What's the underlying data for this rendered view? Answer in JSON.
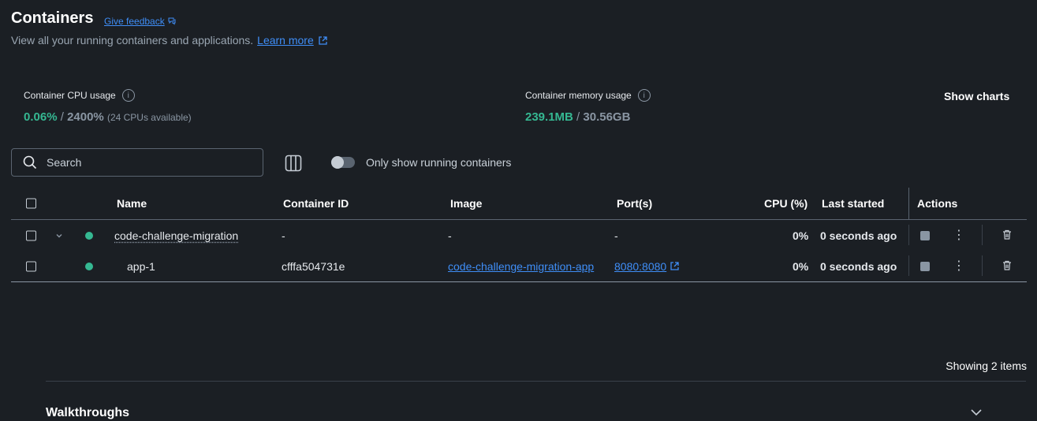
{
  "header": {
    "title": "Containers",
    "feedback_label": "Give feedback",
    "subtitle": "View all your running containers and applications.",
    "learn_more": "Learn more"
  },
  "stats": {
    "cpu_label": "Container CPU usage",
    "cpu_used": "0.06%",
    "cpu_sep": " / ",
    "cpu_total": "2400%",
    "cpu_note": "(24 CPUs available)",
    "mem_label": "Container memory usage",
    "mem_used": "239.1MB",
    "mem_sep": " / ",
    "mem_total": "30.56GB",
    "show_charts": "Show charts"
  },
  "toolbar": {
    "search_placeholder": "Search",
    "toggle_label": "Only show running containers",
    "toggle_on": false
  },
  "table": {
    "columns": [
      "Name",
      "Container ID",
      "Image",
      "Port(s)",
      "CPU (%)",
      "Last started",
      "Actions"
    ],
    "rows": [
      {
        "name": "code-challenge-migration",
        "id": "-",
        "image": "-",
        "ports": "-",
        "cpu": "0%",
        "last_started": "0 seconds ago",
        "status_color": "#35b892"
      },
      {
        "name": "app-1",
        "id": "cfffa504731e",
        "image": "code-challenge-migration-app",
        "ports": "8080:8080",
        "cpu": "0%",
        "last_started": "0 seconds ago",
        "status_color": "#35b892"
      }
    ]
  },
  "footer": {
    "showing": "Showing 2 items",
    "walkthroughs": "Walkthroughs"
  },
  "colors": {
    "accent": "#3f8ef7",
    "running": "#35b892",
    "background": "#1b1f24"
  },
  "icons": [
    "feedback-icon",
    "external-link-icon",
    "info-icon",
    "search-icon",
    "columns-icon",
    "chevron-down-icon",
    "stop-icon",
    "more-vert-icon",
    "trash-icon"
  ]
}
